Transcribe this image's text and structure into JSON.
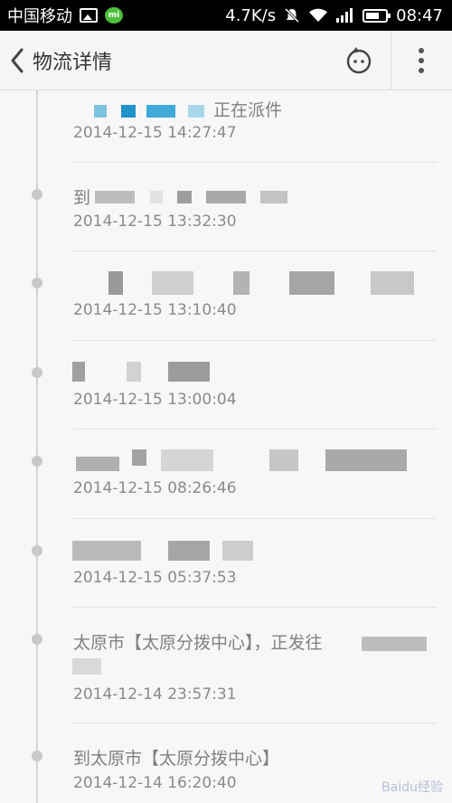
{
  "status_bar": {
    "carrier": "中国移动",
    "network_speed": "4.7K/s",
    "time": "08:47"
  },
  "header": {
    "title": "物流详情"
  },
  "timeline": {
    "entries": [
      {
        "text": "正在派件",
        "time": "2014-12-15 14:27:47"
      },
      {
        "text": "到",
        "time": "2014-12-15 13:32:30"
      },
      {
        "text": "",
        "time": "2014-12-15 13:10:40"
      },
      {
        "text": "",
        "time": "2014-12-15 13:00:04"
      },
      {
        "text": "",
        "time": "2014-12-15 08:26:46"
      },
      {
        "text": "",
        "time": "2014-12-15 05:37:53"
      },
      {
        "text": "太原市【太原分拨中心】，正发往",
        "time": "2014-12-14 23:57:31"
      },
      {
        "text": "到太原市【太原分拨中心】",
        "time": "2014-12-14 16:20:40"
      }
    ]
  },
  "watermark": "Baidu经验"
}
